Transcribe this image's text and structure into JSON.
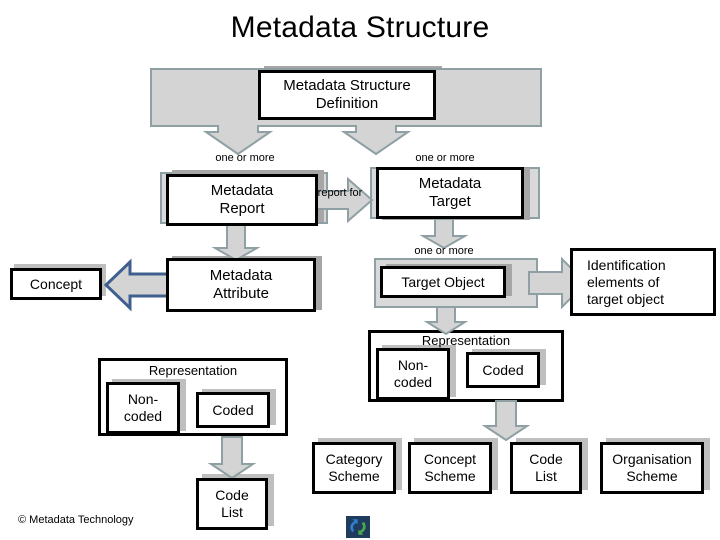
{
  "page": {
    "title": "Metadata Structure",
    "footer_copyright": "© Metadata Technology",
    "logo_icon": "recycle-arrows-icon",
    "background": "#ffffff"
  },
  "colors": {
    "node_border": "#000000",
    "node_fill": "#ffffff",
    "arrow_fill": "#d4d4d4",
    "arrow_stroke": "#8fa0a4",
    "arrow_stroke_blue": "#3f5f8f",
    "band_fill": "#d9d9d9",
    "shadow": "#a6a6a6",
    "text": "#000000"
  },
  "nodes": {
    "msd": "Metadata Structure\nDefinition",
    "msd_line1": "Metadata Structure",
    "msd_line2": "Definition",
    "metadata_report_line1": "Metadata",
    "metadata_report_line2": "Report",
    "metadata_target_line1": "Metadata",
    "metadata_target_line2": "Target",
    "metadata_attribute_line1": "Metadata",
    "metadata_attribute_line2": "Attribute",
    "concept": "Concept",
    "target_object": "Target Object",
    "identification_line1": "Identification",
    "identification_line2": "elements of",
    "identification_line3": "target object",
    "representation_left": "Representation",
    "representation_right": "Representation",
    "noncoded_left_line1": "Non-",
    "noncoded_left_line2": "coded",
    "coded_left": "Coded",
    "noncoded_right_line1": "Non-",
    "noncoded_right_line2": "coded",
    "coded_right": "Coded",
    "code_list_left_line1": "Code",
    "code_list_left_line2": "List",
    "category_scheme_line1": "Category",
    "category_scheme_line2": "Scheme",
    "concept_scheme_line1": "Concept",
    "concept_scheme_line2": "Scheme",
    "code_list_bottom_line1": "Code",
    "code_list_bottom_line2": "List",
    "organisation_scheme_line1": "Organisation",
    "organisation_scheme_line2": "Scheme"
  },
  "edge_labels": {
    "one_or_more_report": "one or more",
    "one_or_more_target": "one or more",
    "report_for": "report for",
    "one_or_more_target_object": "one or more"
  }
}
